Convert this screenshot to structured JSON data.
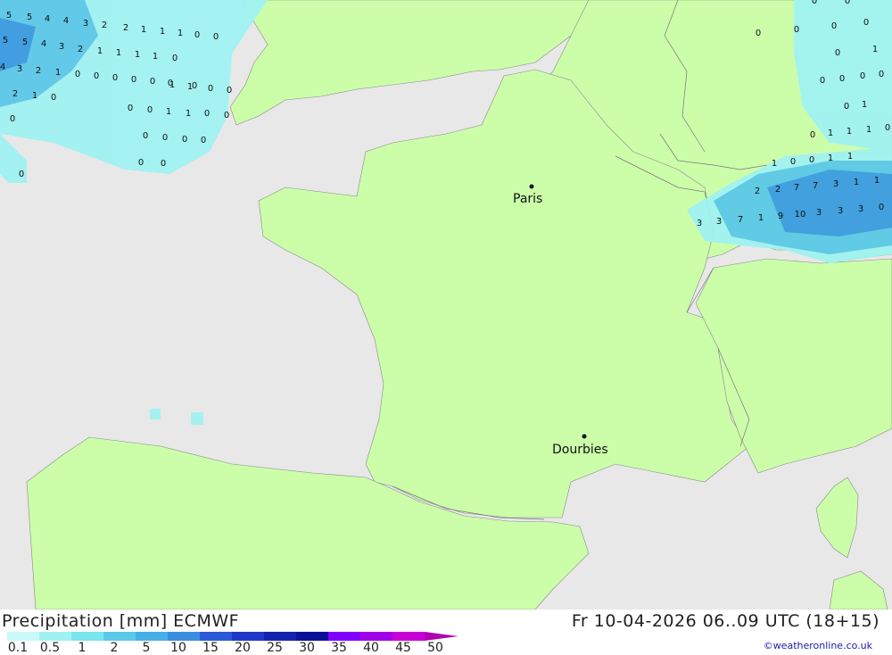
{
  "map": {
    "cities": [
      {
        "name": "Paris"
      },
      {
        "name": "Dourbies"
      }
    ],
    "values": [
      "5",
      "5",
      "4",
      "4",
      "3",
      "2",
      "2",
      "1",
      "1",
      "1",
      "0",
      "0",
      "5",
      "5",
      "4",
      "3",
      "2",
      "1",
      "1",
      "1",
      "1",
      "0",
      "4",
      "3",
      "2",
      "1",
      "0",
      "0",
      "0",
      "0",
      "0",
      "0",
      "0",
      "2",
      "1",
      "0",
      "1",
      "1",
      "0",
      "0",
      "0",
      "0",
      "1",
      "1",
      "0",
      "0",
      "0",
      "0",
      "0",
      "0",
      "0",
      "0",
      "0",
      "0",
      "0",
      "0",
      "0",
      "0",
      "0",
      "0",
      "0",
      "1",
      "0",
      "0",
      "0",
      "0",
      "1",
      "0",
      "0",
      "1",
      "1",
      "1",
      "0",
      "1",
      "0",
      "0",
      "1",
      "1",
      "2",
      "2",
      "7",
      "7",
      "3",
      "1",
      "1",
      "3",
      "3",
      "7",
      "1",
      "9",
      "10",
      "3",
      "3",
      "3",
      "0"
    ],
    "colors": {
      "sea": "#e8e8e8",
      "land": "#ccfeaa",
      "p_light": "#a0f2f2",
      "p_mid": "#5cc8e8",
      "p_heavy": "#3a9be0"
    }
  },
  "footer": {
    "title": "Precipitation [mm] ECMWF",
    "datetime": "Fr 10-04-2026 06..09 UTC (18+15)",
    "credit": "©weatheronline.co.uk",
    "legend_colors": [
      "#c8fafa",
      "#a0f2f2",
      "#78e6ee",
      "#5cc8e8",
      "#46b0e6",
      "#3a8ee0",
      "#2a5ad8",
      "#1e38c8",
      "#1422b0",
      "#0a1098",
      "#8000ff",
      "#a000e6",
      "#c800d8",
      "#e600e6",
      "#c000c0",
      "#b000b0"
    ],
    "legend_ticks": [
      "0.1",
      "0.5",
      "1",
      "2",
      "5",
      "10",
      "15",
      "20",
      "25",
      "30",
      "35",
      "40",
      "45",
      "50"
    ]
  }
}
